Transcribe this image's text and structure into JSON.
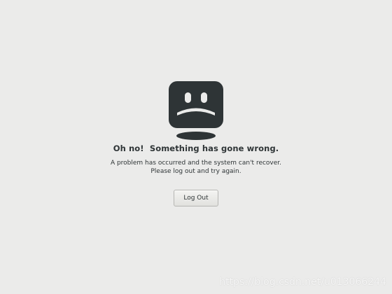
{
  "error_dialog": {
    "icon": "sad-computer-icon",
    "title": "Oh no!  Something has gone wrong.",
    "message_line1": "A problem has occurred and the system can't recover.",
    "message_line2": "Please log out and try again.",
    "logout_label": "Log Out"
  },
  "watermark": {
    "text": "https://blog.csdn.net/u013066244"
  },
  "colors": {
    "background": "#ebebea",
    "icon_fill": "#2e3436",
    "text": "#2e3436"
  }
}
